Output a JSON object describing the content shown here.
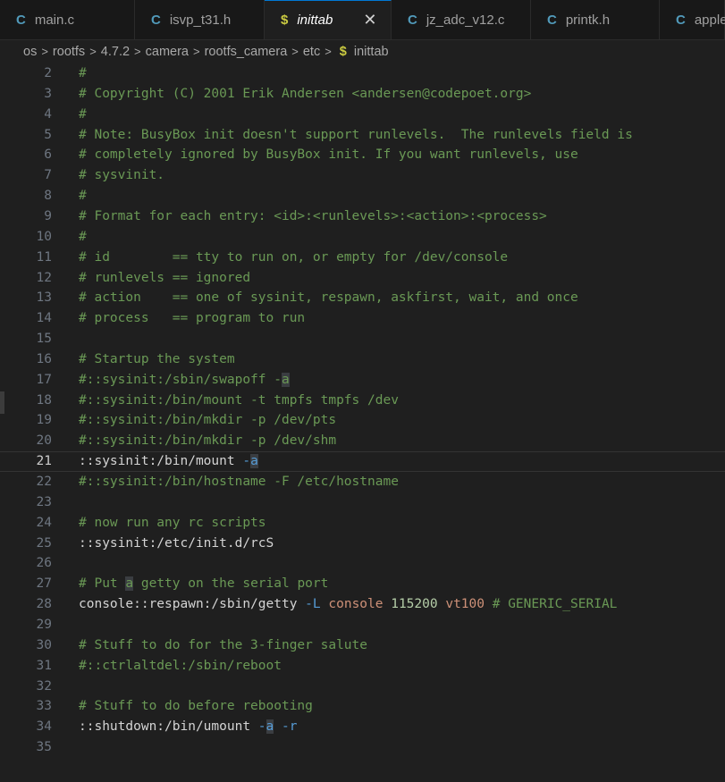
{
  "tabs": [
    {
      "icon": "C",
      "label": "main.c"
    },
    {
      "icon": "C",
      "label": "isvp_t31.h"
    },
    {
      "icon": "$",
      "label": "inittab",
      "active": true
    },
    {
      "icon": "C",
      "label": "jz_adc_v12.c"
    },
    {
      "icon": "C",
      "label": "printk.h"
    },
    {
      "icon": "C",
      "label": "apple"
    }
  ],
  "close_glyph": "✕",
  "breadcrumb": {
    "items": [
      "os",
      "rootfs",
      "4.7.2",
      "camera",
      "rootfs_camera",
      "etc"
    ],
    "file_icon": "$",
    "file": "inittab",
    "separator": ">"
  },
  "editor": {
    "current_line": 21,
    "lines": [
      {
        "n": "2",
        "t": "#"
      },
      {
        "n": "3",
        "t": "# Copyright (C) 2001 Erik Andersen <andersen@codepoet.org>"
      },
      {
        "n": "4",
        "t": "#"
      },
      {
        "n": "5",
        "t": "# Note: BusyBox init doesn't support runlevels.  The runlevels field is"
      },
      {
        "n": "6",
        "t": "# completely ignored by BusyBox init. If you want runlevels, use"
      },
      {
        "n": "7",
        "t": "# sysvinit."
      },
      {
        "n": "8",
        "t": "#"
      },
      {
        "n": "9",
        "t": "# Format for each entry: <id>:<runlevels>:<action>:<process>"
      },
      {
        "n": "10",
        "t": "#"
      },
      {
        "n": "11",
        "t": "# id        == tty to run on, or empty for /dev/console"
      },
      {
        "n": "12",
        "t": "# runlevels == ignored"
      },
      {
        "n": "13",
        "t": "# action    == one of sysinit, respawn, askfirst, wait, and once"
      },
      {
        "n": "14",
        "t": "# process   == program to run"
      },
      {
        "n": "15",
        "t": ""
      },
      {
        "n": "16",
        "t": "# Startup the system"
      },
      {
        "n": "17",
        "t": "#::sysinit:/sbin/swapoff -a"
      },
      {
        "n": "18",
        "t": "#::sysinit:/bin/mount -t tmpfs tmpfs /dev"
      },
      {
        "n": "19",
        "t": "#::sysinit:/bin/mkdir -p /dev/pts"
      },
      {
        "n": "20",
        "t": "#::sysinit:/bin/mkdir -p /dev/shm"
      },
      {
        "n": "21",
        "t": "::sysinit:/bin/mount -a"
      },
      {
        "n": "22",
        "t": "#::sysinit:/bin/hostname -F /etc/hostname"
      },
      {
        "n": "23",
        "t": ""
      },
      {
        "n": "24",
        "t": "# now run any rc scripts"
      },
      {
        "n": "25",
        "t": "::sysinit:/etc/init.d/rcS"
      },
      {
        "n": "26",
        "t": ""
      },
      {
        "n": "27",
        "t": "# Put a getty on the serial port"
      },
      {
        "n": "28",
        "t": "console::respawn:/sbin/getty -L console 115200 vt100 # GENERIC_SERIAL"
      },
      {
        "n": "29",
        "t": ""
      },
      {
        "n": "30",
        "t": "# Stuff to do for the 3-finger salute"
      },
      {
        "n": "31",
        "t": "#::ctrlaltdel:/sbin/reboot"
      },
      {
        "n": "32",
        "t": ""
      },
      {
        "n": "33",
        "t": "# Stuff to do before rebooting"
      },
      {
        "n": "34",
        "t": "::shutdown:/bin/umount -a -r"
      },
      {
        "n": "35",
        "t": ""
      }
    ]
  },
  "colors": {
    "comment": "#6a9955",
    "plain": "#d4d4d4",
    "string": "#ce9178",
    "number": "#b5cea8",
    "option": "#569cd6",
    "c_icon": "#519aba",
    "shell_icon": "#cbcb41",
    "active_tab_border": "#0078d4"
  }
}
